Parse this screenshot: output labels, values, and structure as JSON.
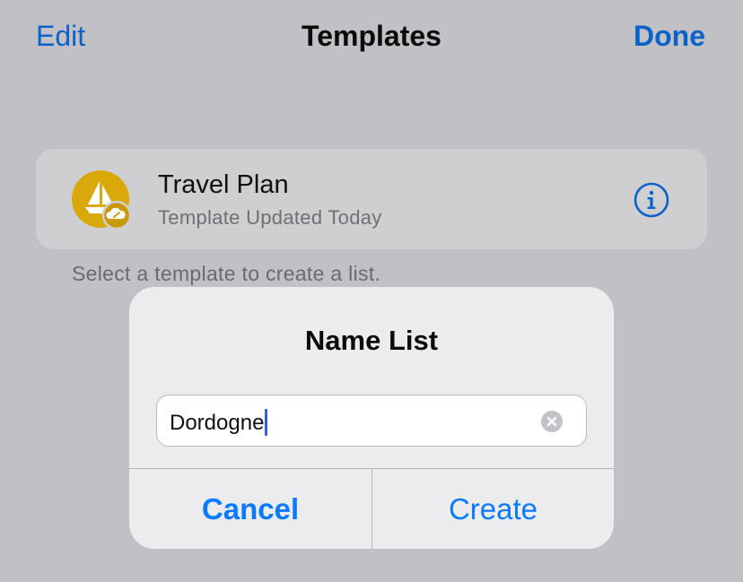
{
  "nav": {
    "edit_label": "Edit",
    "title": "Templates",
    "done_label": "Done"
  },
  "template": {
    "title": "Travel Plan",
    "subtitle": "Template Updated Today",
    "icon": "sailboat-icon",
    "badge_icon": "cloud-link-icon"
  },
  "helper_text": "Select a template to create a list.",
  "dialog": {
    "title": "Name List",
    "field_value": "Dordogne",
    "cancel_label": "Cancel",
    "create_label": "Create"
  },
  "colors": {
    "accent": "#0a7aff",
    "nav_accent": "#0a63c9",
    "icon_yellow": "#d9a90c",
    "dim_background": "#c1c0c5"
  }
}
